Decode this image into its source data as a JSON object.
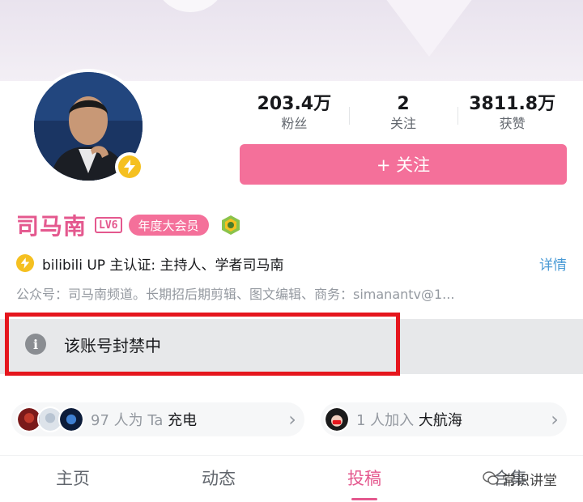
{
  "profile": {
    "name": "司马南",
    "level": "LV6",
    "vip_badge": "年度大会员",
    "certification": "bilibili UP 主认证: 主持人、学者司马南",
    "detail_link": "详情",
    "signature": "公众号：司马南频道。长期招后期剪辑、图文编辑、商务：simanantv@1..."
  },
  "stats": [
    {
      "value": "203.4万",
      "label": "粉丝"
    },
    {
      "value": "2",
      "label": "关注"
    },
    {
      "value": "3811.8万",
      "label": "获赞"
    }
  ],
  "follow_button": {
    "icon": "plus-icon",
    "label": "+ 关注"
  },
  "notice": {
    "text": "该账号封禁中",
    "icon": "info-icon"
  },
  "charge_card": {
    "count": "97 人为 Ta ",
    "action": "充电"
  },
  "fleet_card": {
    "count": "1 人加入 ",
    "action": "大航海"
  },
  "tabs": [
    {
      "label": "主页"
    },
    {
      "label": "动态"
    },
    {
      "label": "投稿",
      "active": true
    },
    {
      "label": "合集"
    }
  ],
  "watermark": "常识讲堂",
  "colors": {
    "accent": "#f4709a",
    "name": "#e4588e",
    "ban_outline": "#e5161d",
    "link": "#4a9bd6"
  }
}
